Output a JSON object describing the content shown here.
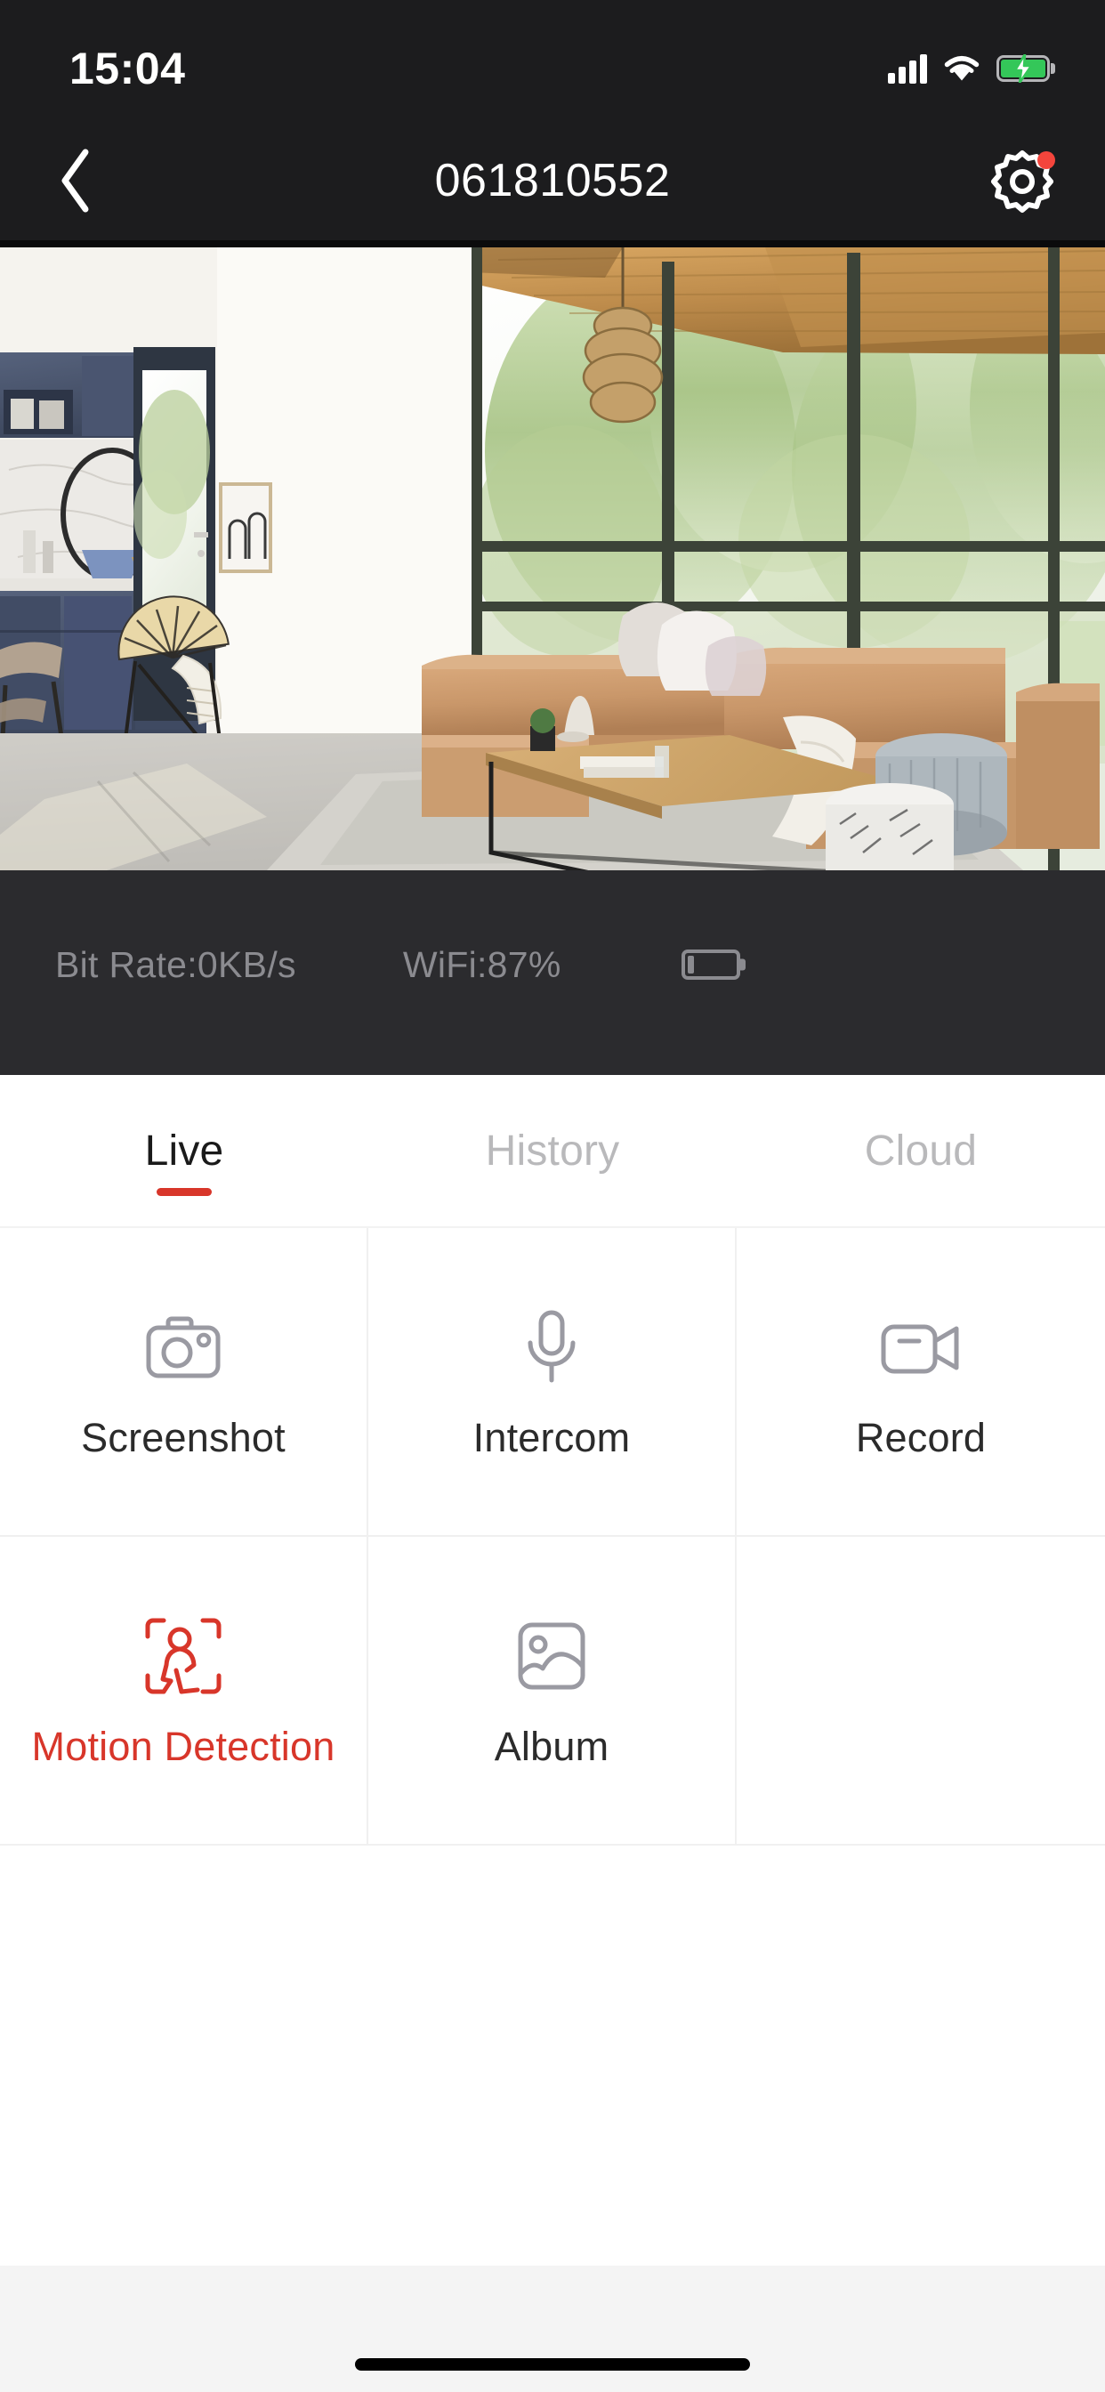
{
  "status_bar": {
    "time": "15:04",
    "cellular_icon": "cellular-signal-icon",
    "cellular_bars": 4,
    "wifi_icon": "wifi-icon",
    "battery_icon": "battery-charging-icon",
    "battery_level_pct": 78,
    "battery_charging": true
  },
  "nav": {
    "back_icon": "chevron-left-icon",
    "title": "061810552",
    "settings_icon": "gear-icon",
    "settings_badge": true,
    "badge_color": "#f4453c"
  },
  "video": {
    "label": "live-camera-feed",
    "description": "Living room with leather sectional sofa, wood coffee table, rattan chair and floor-to-ceiling windows"
  },
  "stats": {
    "bit_rate": "Bit Rate:0KB/s",
    "wifi": "WiFi:87%",
    "battery_icon": "battery-low-icon",
    "battery_level_pct": 14
  },
  "tabs": [
    {
      "label": "Live",
      "active": true
    },
    {
      "label": "History",
      "active": false
    },
    {
      "label": "Cloud",
      "active": false
    }
  ],
  "actions": [
    {
      "label": "Screenshot",
      "icon": "camera-icon",
      "active": false
    },
    {
      "label": "Intercom",
      "icon": "microphone-icon",
      "active": false
    },
    {
      "label": "Record",
      "icon": "video-camera-icon",
      "active": false
    },
    {
      "label": "Motion Detection",
      "icon": "person-detection-icon",
      "active": true
    },
    {
      "label": "Album",
      "icon": "photo-image-icon",
      "active": false
    }
  ],
  "colors": {
    "accent_red": "#d8362a",
    "badge_red": "#f4453c",
    "bar_dark": "#1c1c1e",
    "stats_dark": "#2b2b2e",
    "icon_gray": "#9a9aa2",
    "battery_green": "#34c759"
  },
  "home_indicator": "home-indicator"
}
